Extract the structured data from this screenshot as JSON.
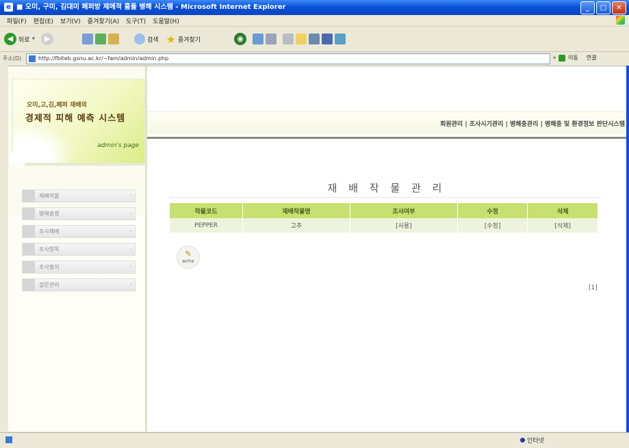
{
  "window": {
    "title": "■ 오미, 구미, 김대미 페퍼방 제메적 흠돌 병해 시스템 - Microsoft Internet Explorer",
    "controls": [
      "_",
      "□",
      "✕"
    ]
  },
  "menubar": [
    "파일(F)",
    "편집(E)",
    "보기(V)",
    "즐겨찾기(A)",
    "도구(T)",
    "도움말(H)"
  ],
  "toolbar": {
    "back": "뒤로",
    "search": "검색",
    "favorites": "즐겨찾기"
  },
  "address": {
    "label": "주소(D)",
    "url": "http://fbiteb.gsnu.ac.kr/~fam/admin/admin.php",
    "go": "이동",
    "links": "연결"
  },
  "logo": {
    "line1": "오미,고,김,페퍼 재배의",
    "line2": "경제적 피해 예측 시스템",
    "subtitle": "admin's page"
  },
  "sidebar": {
    "items": [
      {
        "label": "재배작물"
      },
      {
        "label": "병해충명"
      },
      {
        "label": "조사재배"
      },
      {
        "label": "조사항목"
      },
      {
        "label": "조사필지"
      },
      {
        "label": "설문관리"
      }
    ]
  },
  "nav": {
    "links": "회원관리 | 조사시기관리 | 병해충관리 | 병해충 및 환경정보 판단시스템"
  },
  "main": {
    "title": "재 배 작 물 관 리",
    "table": {
      "headers": [
        "작물코드",
        "재배작물명",
        "조사여부",
        "수정",
        "삭제"
      ],
      "rows": [
        {
          "code": "PEPPER",
          "name": "고추",
          "status": "[사용]",
          "edit": "[수정]",
          "delete": "[삭제]"
        }
      ]
    },
    "write_button": "write",
    "pager": "[1]"
  },
  "status": {
    "zone": "인터넷"
  }
}
